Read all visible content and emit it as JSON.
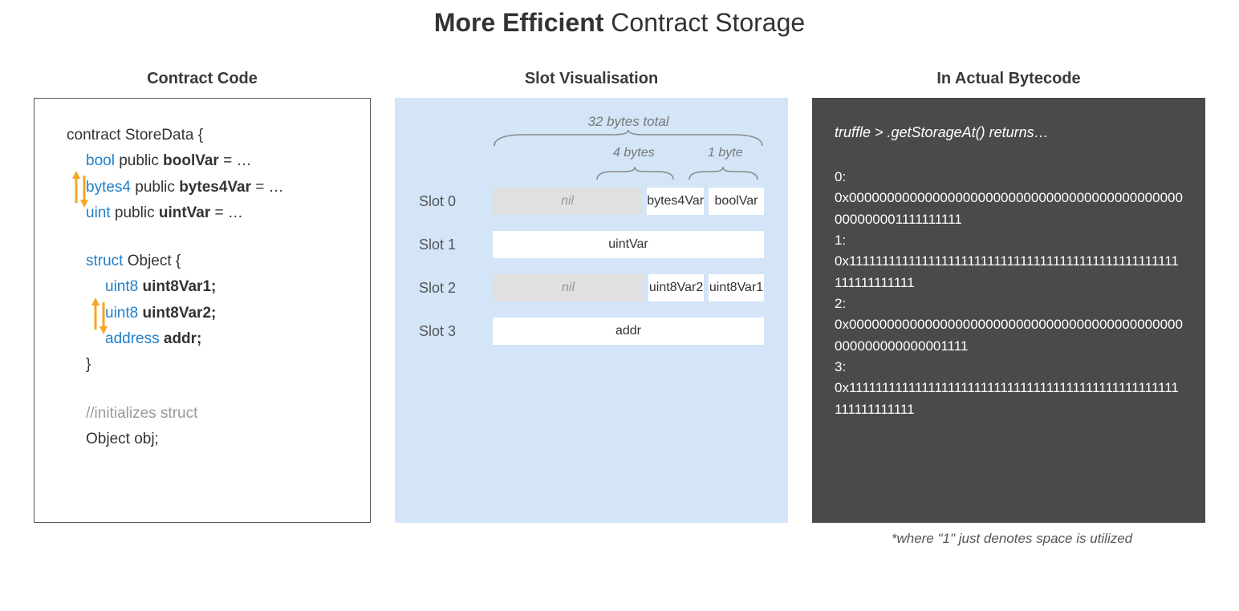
{
  "title": {
    "bold": "More Efficient",
    "rest": " Contract Storage"
  },
  "columns": {
    "code": {
      "title": "Contract Code"
    },
    "slots": {
      "title": "Slot Visualisation"
    },
    "bytecode": {
      "title": "In Actual Bytecode"
    }
  },
  "code": {
    "line1a": "contract StoreData {",
    "line2_kw": "bool",
    "line2_mid": " public ",
    "line2_var": "boolVar",
    "line2_end": " = …",
    "line3_kw": "bytes4",
    "line3_mid": " public ",
    "line3_var": "bytes4Var",
    "line3_end": " = …",
    "line4_kw": "uint",
    "line4_mid": " public ",
    "line4_var": "uintVar",
    "line4_end": " = …",
    "line5_kw": "struct",
    "line5_name": " Object {",
    "line6_kw": "uint8",
    "line6_var": " uint8Var1;",
    "line7_kw": "uint8",
    "line7_var": " uint8Var2;",
    "line8_kw": "address",
    "line8_var": " addr;",
    "line9": "}",
    "line10": "//initializes struct",
    "line11": "Object obj;"
  },
  "slotvis": {
    "total_label": "32 bytes total",
    "b4_label": "4 bytes",
    "b1_label": "1 byte",
    "slot0": "Slot 0",
    "slot1": "Slot 1",
    "slot2": "Slot 2",
    "slot3": "Slot 3",
    "nil": "nil",
    "bytes4Var": "bytes4Var",
    "boolVar": "boolVar",
    "uintVar": "uintVar",
    "uint8Var2": "uint8Var2",
    "uint8Var1": "uint8Var1",
    "addr": "addr"
  },
  "bytecode": {
    "cmd": "truffle > .getStorageAt() returns…",
    "l0": "0:",
    "v0": "0x00000000000000000000000000000000000000000000000000001111111111",
    "l1": "1:",
    "v1": "0x11111111111111111111111111111111111111111111111111111111111111",
    "l2": "2:",
    "v2": "0x00000000000000000000000000000000000000000000000000000000001111",
    "l3": "3:",
    "v3": "0x11111111111111111111111111111111111111111111111111111111111111",
    "footnote": "*where \"1\" just denotes space is utilized"
  }
}
